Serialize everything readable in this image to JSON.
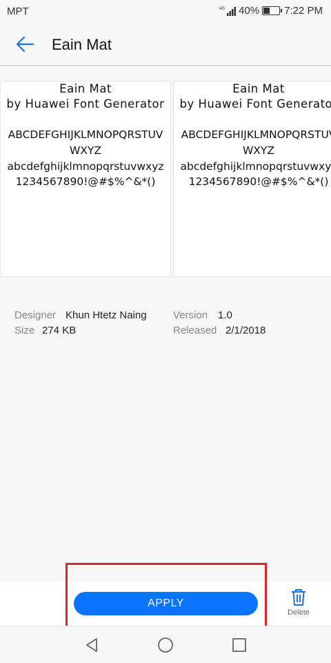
{
  "status_bar": {
    "carrier": "MPT",
    "network": "4G",
    "battery": "40%",
    "battery_level": 0.4,
    "time": "7:22 PM"
  },
  "app_bar": {
    "title": "Eain Mat",
    "back_icon": "arrow-left-icon"
  },
  "preview": {
    "line1": "Eain Mat",
    "line2": "by Huawei Font Generator",
    "upper": "ABCDEFGHIJKLMNOPQRSTUV\nWXYZ",
    "lower": "abcdefghijklmnopqrstuvwxyz",
    "numbers": "1234567890!@#$%^&*()"
  },
  "info": {
    "designer_label": "Designer",
    "designer": "Khun Htetz Naing",
    "size_label": "Size",
    "size": "274 KB",
    "version_label": "Version",
    "version": "1.0",
    "released_label": "Released",
    "released": "2/1/2018"
  },
  "actions": {
    "apply_label": "APPLY",
    "delete_label": "Delete",
    "apply_color": "#0a73ff"
  },
  "nav": {
    "back_icon": "triangle-back-icon",
    "home_icon": "circle-home-icon",
    "recents_icon": "square-recents-icon"
  }
}
